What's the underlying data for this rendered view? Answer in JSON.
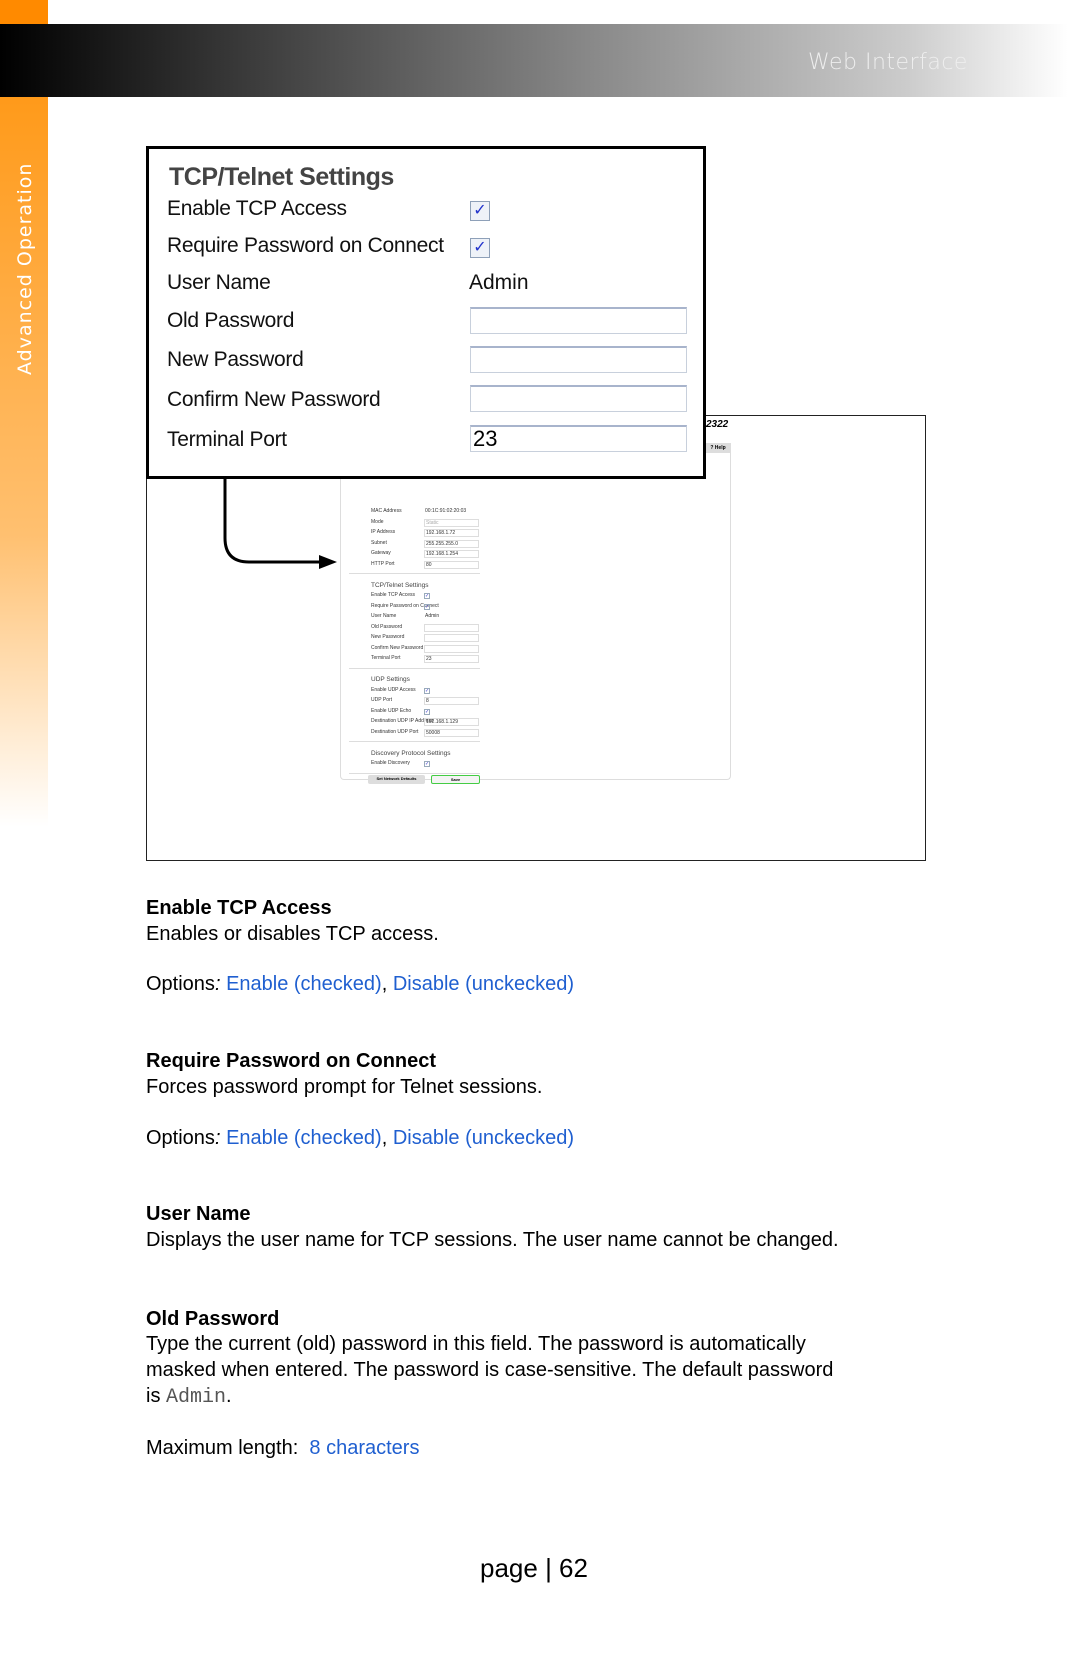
{
  "header": {
    "title": "Web Interface",
    "section": "Advanced Operation"
  },
  "screenshot": {
    "model": "2322",
    "help": "? Help",
    "rows": [
      {
        "label": "MAC Address",
        "value": "00:1C:91:02:20:03",
        "kind": "text"
      },
      {
        "label": "Mode",
        "value": "Static",
        "kind": "select"
      },
      {
        "label": "IP Address",
        "value": "192.168.1.72",
        "kind": "input"
      },
      {
        "label": "Subnet",
        "value": "255.255.255.0",
        "kind": "input"
      },
      {
        "label": "Gateway",
        "value": "192.168.1.254",
        "kind": "input"
      },
      {
        "label": "HTTP Port",
        "value": "80",
        "kind": "input"
      },
      {
        "kind": "sep"
      },
      {
        "label": "TCP/Telnet Settings",
        "kind": "header"
      },
      {
        "label": "Enable TCP Access",
        "kind": "check"
      },
      {
        "label": "Require Password on Connect",
        "kind": "check"
      },
      {
        "label": "User Name",
        "value": "Admin",
        "kind": "text"
      },
      {
        "label": "Old Password",
        "value": "",
        "kind": "input"
      },
      {
        "label": "New Password",
        "value": "",
        "kind": "input"
      },
      {
        "label": "Confirm New Password",
        "value": "",
        "kind": "input"
      },
      {
        "label": "Terminal Port",
        "value": "23",
        "kind": "input"
      },
      {
        "kind": "sep"
      },
      {
        "label": "UDP Settings",
        "kind": "header"
      },
      {
        "label": "Enable UDP Access",
        "kind": "check"
      },
      {
        "label": "UDP Port",
        "value": "8",
        "kind": "input"
      },
      {
        "label": "Enable UDP Echo",
        "kind": "check"
      },
      {
        "label": "Destination UDP IP Address",
        "value": "192.168.1.129",
        "kind": "input"
      },
      {
        "label": "Destination UDP Port",
        "value": "50008",
        "kind": "input"
      },
      {
        "kind": "sep"
      },
      {
        "label": "Discovery Protocol Settings",
        "kind": "header"
      },
      {
        "label": "Enable Discovery",
        "kind": "check"
      },
      {
        "kind": "sep"
      }
    ],
    "buttons": {
      "defaults": "Set Network Defaults",
      "save": "Save"
    }
  },
  "callout": {
    "title": "TCP/Telnet Settings",
    "enable_tcp": "Enable TCP Access",
    "require_pw": "Require Password on Connect",
    "user_name": "User Name",
    "user_value": "Admin",
    "old_pw": "Old Password",
    "new_pw": "New Password",
    "confirm_pw": "Confirm New Password",
    "terminal_port": "Terminal Port",
    "terminal_value": "23",
    "check": "✓"
  },
  "doc": {
    "s1_title": "Enable TCP Access",
    "s1_desc": "Enables or disables TCP access.",
    "options": "Options",
    ":": ":",
    "opt_enable": "Enable (checked)",
    "opt_disable": "Disable (unckecked)",
    "comma": ", ",
    "s2_title": "Require Password on Connect",
    "s2_desc": "Forces password prompt for Telnet sessions.",
    "s3_title": "User Name",
    "s3_desc": "Displays the user name for TCP sessions.  The user name cannot be changed.",
    "s4_title": "Old Password",
    "s4_l1": "Type the current (old) password in this field.  The password is automatically",
    "s4_l2": "masked when entered.  The password is case-sensitive.  The default password",
    "s4_l3a": "is ",
    "s4_l3b": "Admin",
    "s4_l3c": ".",
    "maxlen": "Maximum length:  ",
    "maxlen_val": "8 characters"
  },
  "page": {
    "label": "page | 62"
  },
  "colors": {
    "accent": "#ff8a00",
    "link": "#1f5fd0"
  }
}
